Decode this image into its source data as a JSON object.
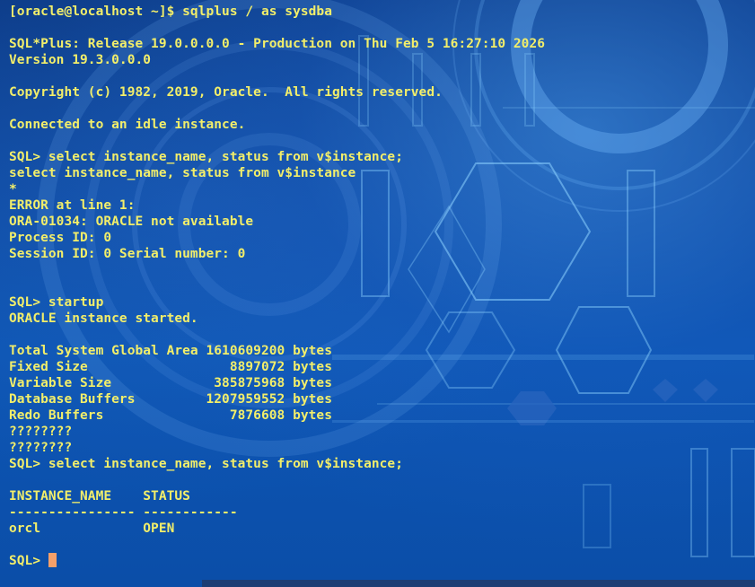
{
  "terminal": {
    "lines": [
      "[oracle@localhost ~]$ sqlplus / as sysdba",
      "",
      "SQL*Plus: Release 19.0.0.0.0 - Production on Thu Feb 5 16:27:10 2026",
      "Version 19.3.0.0.0",
      "",
      "Copyright (c) 1982, 2019, Oracle.  All rights reserved.",
      "",
      "Connected to an idle instance.",
      "",
      "SQL> select instance_name, status from v$instance;",
      "select instance_name, status from v$instance",
      "*",
      "ERROR at line 1:",
      "ORA-01034: ORACLE not available",
      "Process ID: 0",
      "Session ID: 0 Serial number: 0",
      "",
      "",
      "SQL> startup",
      "ORACLE instance started.",
      "",
      "Total System Global Area 1610609200 bytes",
      "Fixed Size                  8897072 bytes",
      "Variable Size             385875968 bytes",
      "Database Buffers         1207959552 bytes",
      "Redo Buffers                7876608 bytes",
      "????????",
      "????????",
      "SQL> select instance_name, status from v$instance;",
      "",
      "INSTANCE_NAME    STATUS",
      "---------------- ------------",
      "orcl             OPEN",
      ""
    ],
    "prompt": "SQL> ",
    "colors": {
      "text": "#f2ee6a",
      "cursor": "#f5a06a",
      "background": "#0b3f8f"
    }
  }
}
